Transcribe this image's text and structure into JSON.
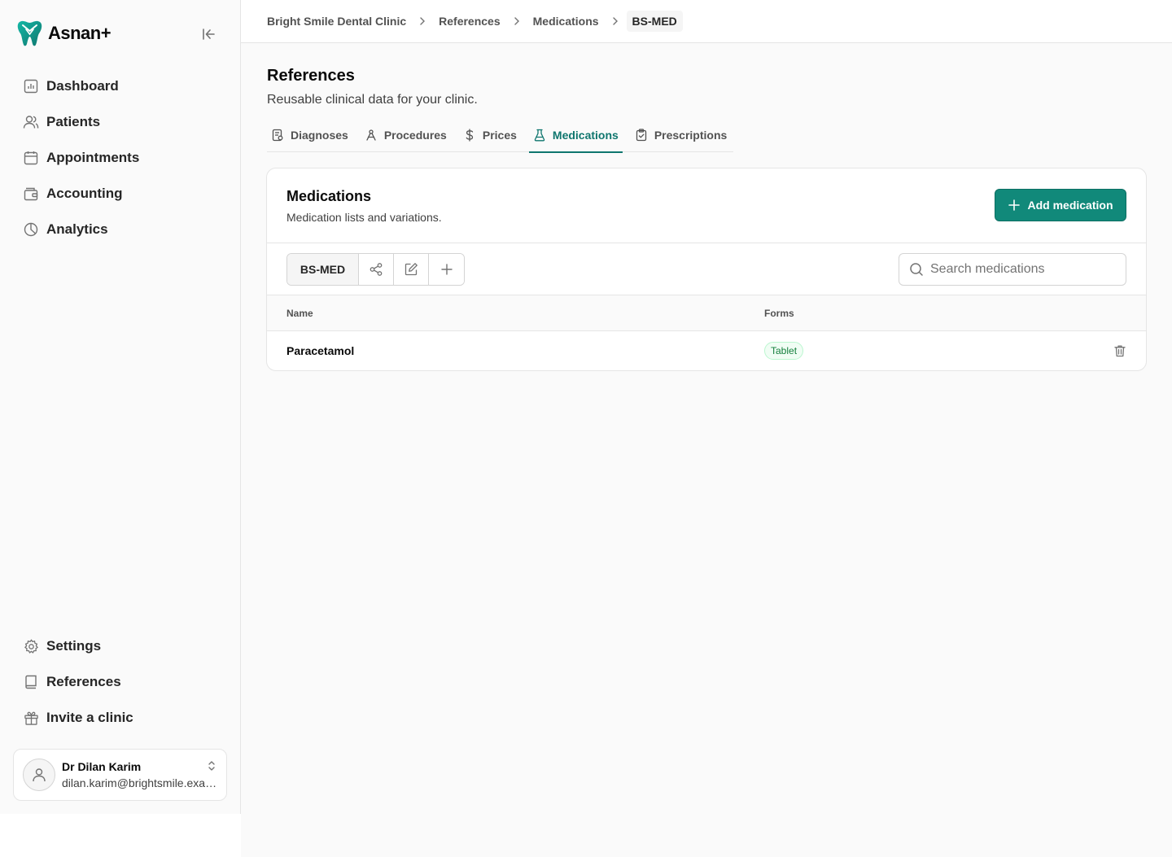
{
  "app": {
    "name": "Asnan+"
  },
  "sidebar": {
    "top_items": [
      {
        "label": "Dashboard",
        "icon": "chart-icon"
      },
      {
        "label": "Patients",
        "icon": "users-icon"
      },
      {
        "label": "Appointments",
        "icon": "calendar-icon"
      },
      {
        "label": "Accounting",
        "icon": "wallet-icon"
      },
      {
        "label": "Analytics",
        "icon": "pie-chart-icon"
      }
    ],
    "bottom_items": [
      {
        "label": "Settings",
        "icon": "gear-icon"
      },
      {
        "label": "References",
        "icon": "book-icon"
      },
      {
        "label": "Invite a clinic",
        "icon": "gift-icon"
      }
    ],
    "user": {
      "name": "Dr Dilan Karim",
      "email": "dilan.karim@brightsmile.example"
    }
  },
  "breadcrumb": {
    "items": [
      "Bright Smile Dental Clinic",
      "References",
      "Medications"
    ],
    "current": "BS-MED"
  },
  "page": {
    "title": "References",
    "subtitle": "Reusable clinical data for your clinic."
  },
  "tabs": [
    {
      "label": "Diagnoses",
      "icon": "clipboard-text-icon",
      "active": false
    },
    {
      "label": "Procedures",
      "icon": "tool-icon",
      "active": false
    },
    {
      "label": "Prices",
      "icon": "dollar-icon",
      "active": false
    },
    {
      "label": "Medications",
      "icon": "flask-icon",
      "active": true
    },
    {
      "label": "Prescriptions",
      "icon": "clipboard-check-icon",
      "active": false
    }
  ],
  "card": {
    "title": "Medications",
    "description": "Medication lists and variations.",
    "add_button_label": "Add medication",
    "list_selector_label": "BS-MED",
    "search_placeholder": "Search medications",
    "columns": {
      "name": "Name",
      "forms": "Forms"
    },
    "rows": [
      {
        "name": "Paracetamol",
        "forms": [
          "Tablet"
        ]
      }
    ]
  },
  "colors": {
    "accent": "#0f766e",
    "primary_button": "#11897a",
    "badge_text": "#15803d",
    "badge_bg": "#f0fdf4"
  }
}
